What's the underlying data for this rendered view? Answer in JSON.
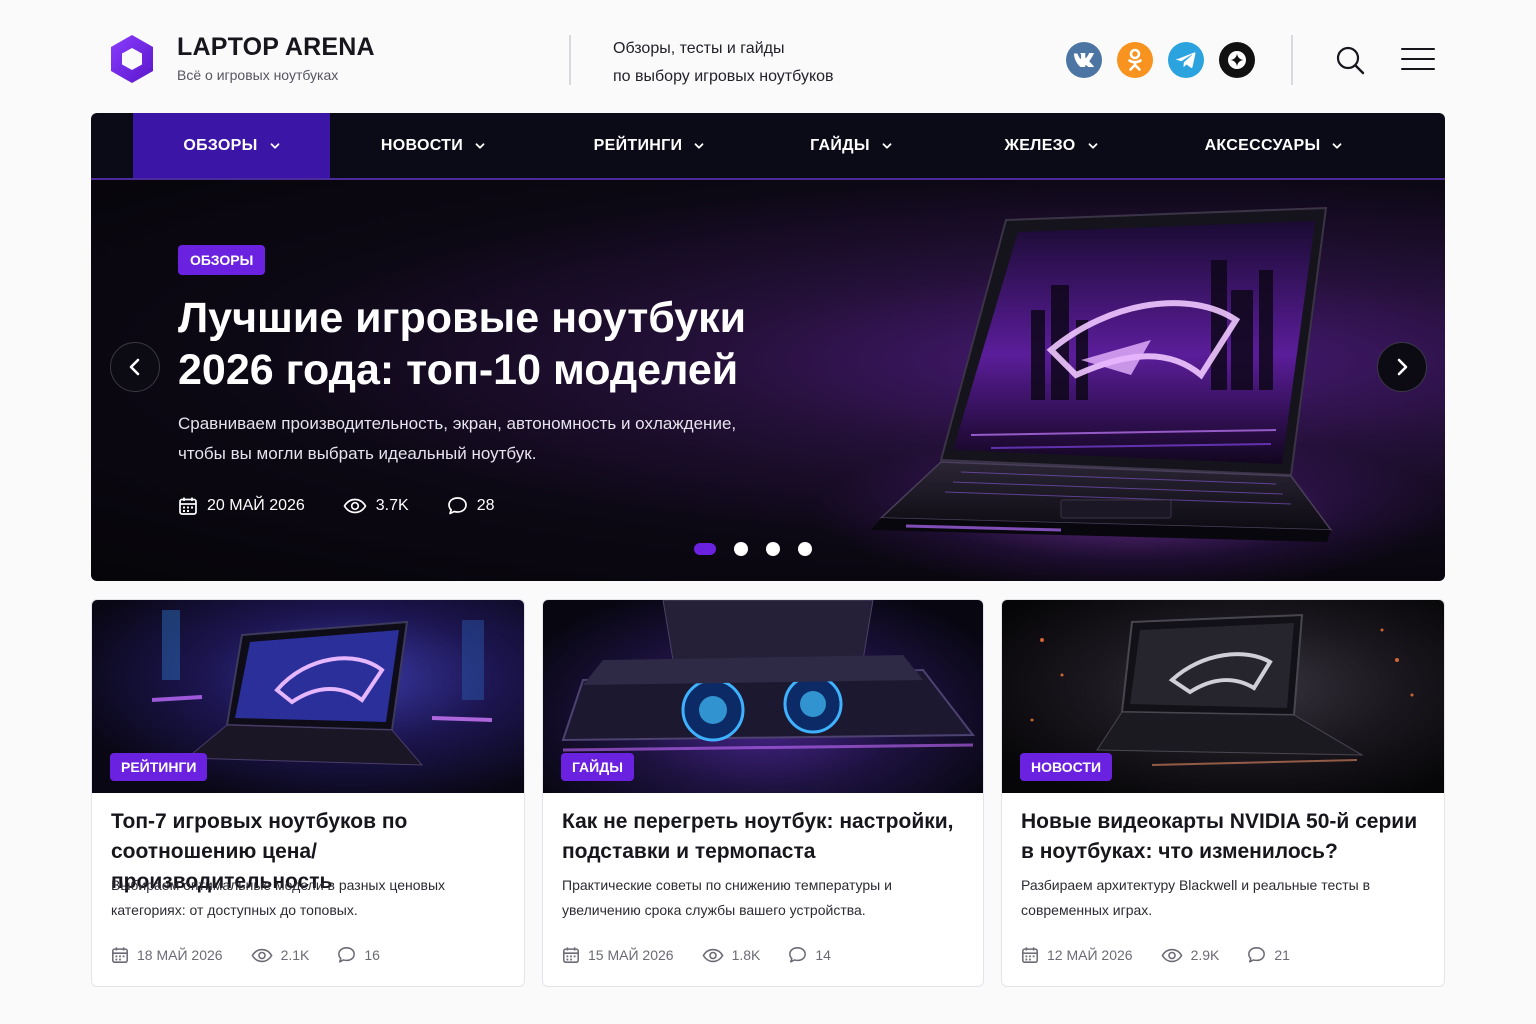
{
  "header": {
    "brand_title": "LAPTOP ARENA",
    "brand_subtitle": "Всё о игровых ноутбуках",
    "tagline_line1": "Обзоры, тесты и гайды",
    "tagline_line2": "по выбору игровых ноутбуков",
    "social": [
      {
        "name": "vk",
        "color": "#4c75a3"
      },
      {
        "name": "odnoklassniki",
        "color": "#f7931e"
      },
      {
        "name": "telegram",
        "color": "#2aa3de"
      },
      {
        "name": "dzen",
        "color": "#111111"
      }
    ]
  },
  "nav": {
    "items": [
      {
        "label": "ОБЗОРЫ",
        "active": true
      },
      {
        "label": "НОВОСТИ"
      },
      {
        "label": "РЕЙТИНГИ"
      },
      {
        "label": "ГАЙДЫ"
      },
      {
        "label": "ЖЕЛЕЗО"
      },
      {
        "label": "АКСЕССУАРЫ"
      }
    ]
  },
  "hero": {
    "badge": "ОБЗОРЫ",
    "title": "Лучшие игровые ноутбуки 2026 года: топ-10 моделей",
    "description": "Сравниваем производительность, экран, автономность и охлаждение, чтобы вы могли выбрать идеальный ноутбук.",
    "date": "20 МАЙ 2026",
    "views": "3.7K",
    "comments": "28",
    "slides_total": 4,
    "active_slide": 1
  },
  "cards": [
    {
      "badge": "РЕЙТИНГИ",
      "title": "Топ-7 игровых ноутбуков по соотношению цена/производительность",
      "description": "Выбираем оптимальные модели в разных ценовых категориях: от доступных до топовых.",
      "date": "18 МАЙ 2026",
      "views": "2.1K",
      "comments": "16"
    },
    {
      "badge": "ГАЙДЫ",
      "title": "Как не перегреть ноутбук: настройки, подставки и термопаста",
      "description": "Практические советы по снижению температуры и увеличению срока службы вашего устройства.",
      "date": "15 МАЙ 2026",
      "views": "1.8K",
      "comments": "14"
    },
    {
      "badge": "НОВОСТИ",
      "title": "Новые видеокарты NVIDIA 50-й серии в ноутбуках: что изменилось?",
      "description": "Разбираем архитектуру Blackwell и реальные тесты в современных играх.",
      "date": "12 МАЙ 2026",
      "views": "2.9K",
      "comments": "21"
    }
  ],
  "colors": {
    "accent": "#6a22e0",
    "nav_active": "#3b15a6",
    "nav_bg": "#0b0a17"
  }
}
